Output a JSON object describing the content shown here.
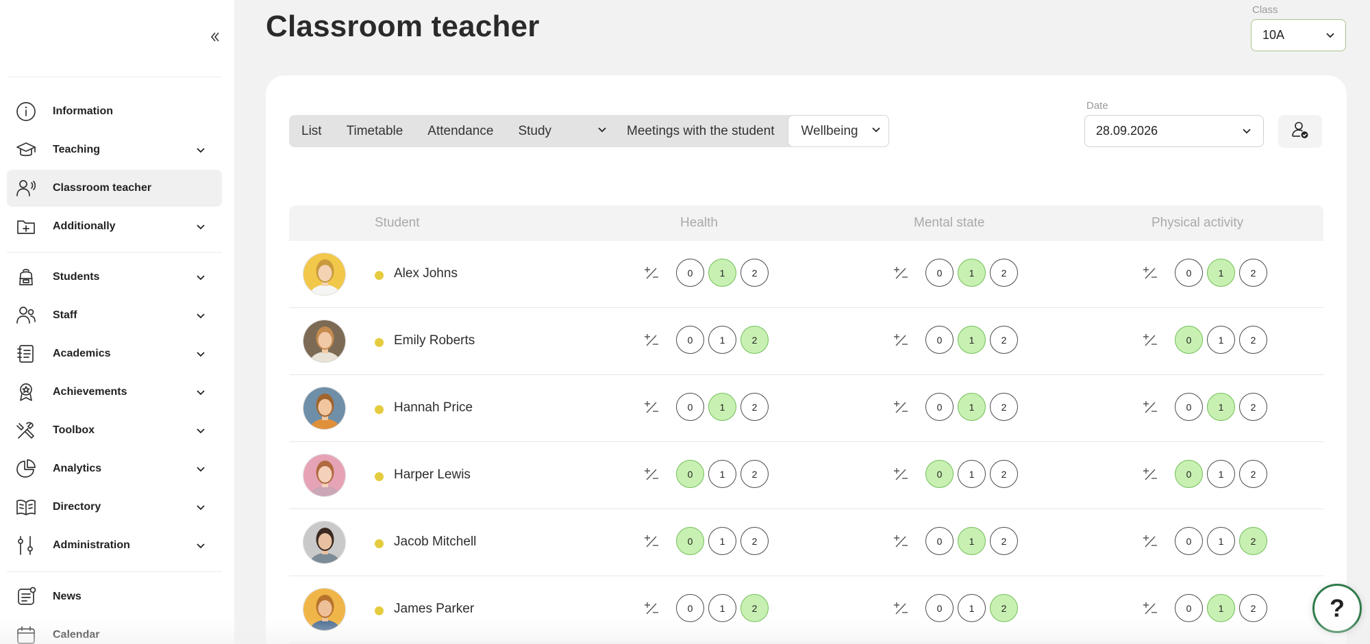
{
  "page": {
    "title": "Classroom teacher"
  },
  "class_select": {
    "label": "Class",
    "value": "10A"
  },
  "sidebar": {
    "items": [
      {
        "label": "Information",
        "icon": "info-icon",
        "chevron": false
      },
      {
        "label": "Teaching",
        "icon": "graduation-cap-icon",
        "chevron": true
      },
      {
        "label": "Classroom teacher",
        "icon": "teacher-icon",
        "chevron": false,
        "active": true
      },
      {
        "label": "Additionally",
        "icon": "folder-plus-icon",
        "chevron": true
      },
      {
        "label": "Students",
        "icon": "backpack-icon",
        "chevron": true
      },
      {
        "label": "Staff",
        "icon": "staff-icon",
        "chevron": true
      },
      {
        "label": "Academics",
        "icon": "notebook-icon",
        "chevron": true
      },
      {
        "label": "Achievements",
        "icon": "award-icon",
        "chevron": true
      },
      {
        "label": "Toolbox",
        "icon": "tools-icon",
        "chevron": true
      },
      {
        "label": "Analytics",
        "icon": "pie-chart-icon",
        "chevron": true
      },
      {
        "label": "Directory",
        "icon": "book-icon",
        "chevron": true
      },
      {
        "label": "Administration",
        "icon": "sliders-icon",
        "chevron": true
      },
      {
        "label": "News",
        "icon": "news-icon",
        "chevron": false
      },
      {
        "label": "Calendar",
        "icon": "calendar-icon",
        "chevron": false
      }
    ]
  },
  "tabs": {
    "list": "List",
    "timetable": "Timetable",
    "attendance": "Attendance",
    "study": "Study",
    "meetings": "Meetings with the student",
    "wellbeing": "Wellbeing"
  },
  "date": {
    "label": "Date",
    "value": "28.09.2026"
  },
  "table": {
    "headers": {
      "student": "Student",
      "health": "Health",
      "mental": "Mental state",
      "physical": "Physical activity"
    },
    "score_options": [
      "0",
      "1",
      "2"
    ],
    "rows": [
      {
        "name": "Alex Johns",
        "health": 1,
        "mental": 1,
        "physical": 1,
        "avatar_bg": "#f2c84b",
        "hair": "#c99a3c",
        "skin": "#f3d3b4",
        "shirt": "#f5f5f5"
      },
      {
        "name": "Emily Roberts",
        "health": 2,
        "mental": 1,
        "physical": 0,
        "avatar_bg": "#7c6a54",
        "hair": "#c48a4e",
        "skin": "#f0c9a6",
        "shirt": "#e9e2d6"
      },
      {
        "name": "Hannah Price",
        "health": 1,
        "mental": 1,
        "physical": 1,
        "avatar_bg": "#6f8fa8",
        "hair": "#a0652f",
        "skin": "#f1c7a0",
        "shirt": "#e0903a"
      },
      {
        "name": "Harper Lewis",
        "health": 0,
        "mental": 0,
        "physical": 0,
        "avatar_bg": "#e7a3b6",
        "hair": "#b06a3f",
        "skin": "#f4d1bb",
        "shirt": "#caa6b7"
      },
      {
        "name": "Jacob Mitchell",
        "health": 0,
        "mental": 1,
        "physical": 2,
        "avatar_bg": "#c9c9c9",
        "hair": "#3a2a22",
        "skin": "#e8c1a0",
        "shirt": "#7d8b97"
      },
      {
        "name": "James Parker",
        "health": 2,
        "mental": 2,
        "physical": 1,
        "avatar_bg": "#f0b548",
        "hair": "#b8742e",
        "skin": "#eec09a",
        "shirt": "#4e6f94"
      }
    ]
  },
  "help": {
    "label": "?"
  },
  "colors": {
    "accent": "#c9f0b3",
    "accent_border": "#6fbf56",
    "status_dot": "#e5cc3f",
    "help_border": "#2f7b4a"
  }
}
